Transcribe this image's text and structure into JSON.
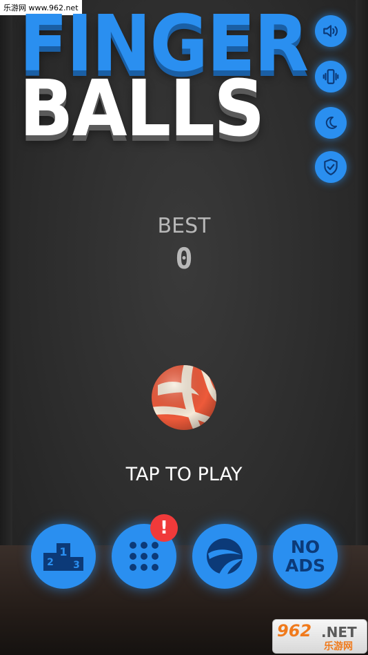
{
  "watermark": {
    "top_left": "乐游网 www.962.net",
    "logo_main": "962",
    "logo_net": ".NET",
    "logo_sub": "乐游网"
  },
  "title": {
    "line1": "FINGER",
    "line2": "BALLS"
  },
  "side_buttons": [
    {
      "icon": "speaker-icon"
    },
    {
      "icon": "vibration-icon"
    },
    {
      "icon": "moon-icon"
    },
    {
      "icon": "shield-check-icon"
    }
  ],
  "score": {
    "best_label": "BEST",
    "best_value": "0"
  },
  "prompt": "TAP TO PLAY",
  "bottom_buttons": [
    {
      "icon": "leaderboard-podium-icon"
    },
    {
      "icon": "ball-grid-icon",
      "badge": "!"
    },
    {
      "icon": "ball-skin-icon"
    },
    {
      "label_line1": "NO",
      "label_line2": "ADS"
    }
  ],
  "colors": {
    "accent": "#2a8ff0",
    "badge": "#f03a3a",
    "ball": "#ee5a3a",
    "text": "#ffffff",
    "best": "#b8b8b8"
  }
}
